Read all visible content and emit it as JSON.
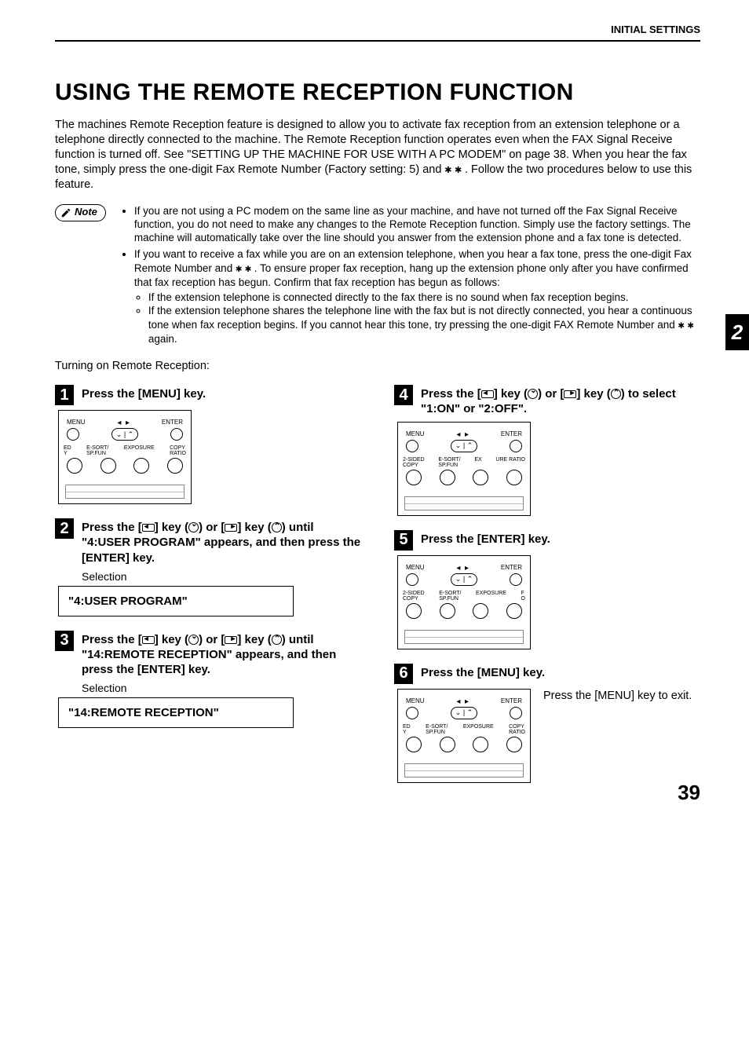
{
  "header": {
    "section": "INITIAL SETTINGS"
  },
  "title": "USING THE REMOTE RECEPTION FUNCTION",
  "intro": {
    "p1_a": "The machines Remote Reception feature is designed to allow you to activate fax reception from an extension telephone or a telephone directly connected to the machine. The Remote Reception function operates even when the FAX Signal Receive function is turned off. See \"SETTING UP THE MACHINE FOR USE WITH A PC MODEM\" on page 38. When you hear the fax tone, simply press the one-digit Fax Remote Number (Factory setting: 5) and ",
    "p1_b": ". Follow the two procedures below to use this feature."
  },
  "note_label": "Note",
  "notes": {
    "b1": "If you are not using a PC modem on the same line as your machine, and have not turned off the Fax Signal Receive function, you do not need to make any changes to the Remote Reception function. Simply use the factory settings. The machine will automatically take over the line should you answer from the extension phone and a fax tone is detected.",
    "b2_a": "If you want to receive a fax while you are on an extension telephone, when you hear a fax tone, press the one-digit Fax Remote Number and ",
    "b2_b": ". To ensure proper fax reception, hang up the extension phone only after you have confirmed that fax reception has begun. Confirm that fax reception has begun as follows:",
    "s1": "If the extension telephone is connected directly to the fax there is no sound when fax reception begins.",
    "s2_a": "If the extension telephone shares the telephone line with the fax but is not directly connected, you hear a continuous tone when fax reception begins. If you cannot hear this tone, try pressing the one-digit FAX Remote Number and ",
    "s2_b": " again."
  },
  "subhead": "Turning on Remote Reception:",
  "steps": {
    "s1": {
      "num": "1",
      "title": "Press the [MENU] key."
    },
    "s2": {
      "num": "2",
      "title_a": "Press the [",
      "title_b": "] key (",
      "title_c": ") or [",
      "title_d": "] key (",
      "title_e": ") until \"4:USER PROGRAM\" appears, and then press the [ENTER] key.",
      "sel_label": "Selection",
      "sel_value": "\"4:USER PROGRAM\""
    },
    "s3": {
      "num": "3",
      "title_a": "Press the [",
      "title_b": "] key (",
      "title_c": ") or [",
      "title_d": "] key (",
      "title_e": ") until \"14:REMOTE RECEPTION\" appears, and then press the [ENTER] key.",
      "sel_label": "Selection",
      "sel_value": "\"14:REMOTE RECEPTION\""
    },
    "s4": {
      "num": "4",
      "title_a": "Press the [",
      "title_b": "] key (",
      "title_c": ") or [",
      "title_d": "] key (",
      "title_e": ") to select \"1:ON\" or \"2:OFF\"."
    },
    "s5": {
      "num": "5",
      "title": "Press the [ENTER] key."
    },
    "s6": {
      "num": "6",
      "title": "Press the [MENU] key.",
      "aside": "Press the [MENU] key to exit."
    }
  },
  "panel": {
    "menu": "MENU",
    "enter": "ENTER",
    "l1a": "2-SIDED",
    "l1b": "COPY",
    "l2a": "E-SORT/",
    "l2b": "SP.FUN",
    "l3": "EXPOSURE",
    "l4a": "COPY",
    "l4b": "RATIO",
    "alt_l1a": "ED",
    "alt_l1b": "Y"
  },
  "tab_num": "2",
  "page_num": "39"
}
